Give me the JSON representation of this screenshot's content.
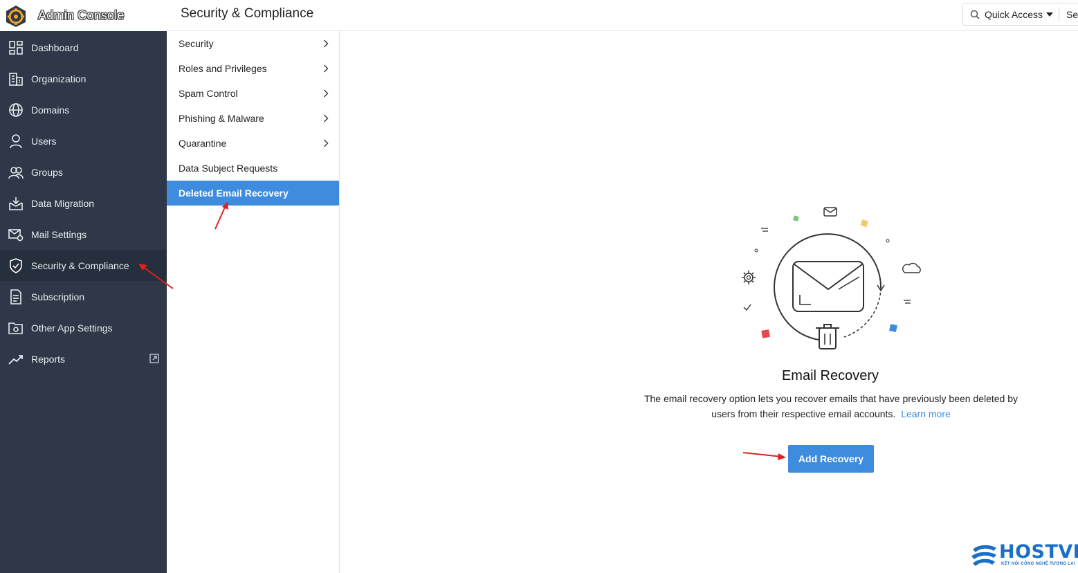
{
  "header": {
    "app_name": "Admin Console",
    "page_title": "Security & Compliance",
    "quick_access_label": "Quick Access",
    "more_label": "Se"
  },
  "sidebar": {
    "items": [
      {
        "label": "Dashboard",
        "icon": "dashboard-icon"
      },
      {
        "label": "Organization",
        "icon": "building-icon"
      },
      {
        "label": "Domains",
        "icon": "globe-icon"
      },
      {
        "label": "Users",
        "icon": "user-icon"
      },
      {
        "label": "Groups",
        "icon": "group-icon"
      },
      {
        "label": "Data Migration",
        "icon": "inbox-download-icon"
      },
      {
        "label": "Mail Settings",
        "icon": "mail-gear-icon"
      },
      {
        "label": "Security & Compliance",
        "icon": "shield-icon",
        "active": true
      },
      {
        "label": "Subscription",
        "icon": "document-icon"
      },
      {
        "label": "Other App Settings",
        "icon": "folder-gear-icon"
      },
      {
        "label": "Reports",
        "icon": "trend-icon"
      }
    ]
  },
  "submenu": {
    "items": [
      {
        "label": "Security",
        "has_children": true
      },
      {
        "label": "Roles and Privileges",
        "has_children": true
      },
      {
        "label": "Spam Control",
        "has_children": true
      },
      {
        "label": "Phishing & Malware",
        "has_children": true
      },
      {
        "label": "Quarantine",
        "has_children": true
      },
      {
        "label": "Data Subject Requests",
        "has_children": false
      },
      {
        "label": "Deleted Email Recovery",
        "has_children": false,
        "active": true
      }
    ]
  },
  "main": {
    "empty_title": "Email Recovery",
    "empty_description": "The email recovery option lets you recover emails that have previously been deleted by users from their respective email accounts.",
    "learn_more_label": "Learn more",
    "add_button_label": "Add Recovery"
  },
  "watermark": {
    "brand": "HOSTVN",
    "tagline": "KẾT NỐI CÔNG NGHỆ TƯƠNG LAI"
  },
  "colors": {
    "sidebar_bg": "#2e3848",
    "accent": "#3d8cde",
    "annotation": "#e02020"
  }
}
